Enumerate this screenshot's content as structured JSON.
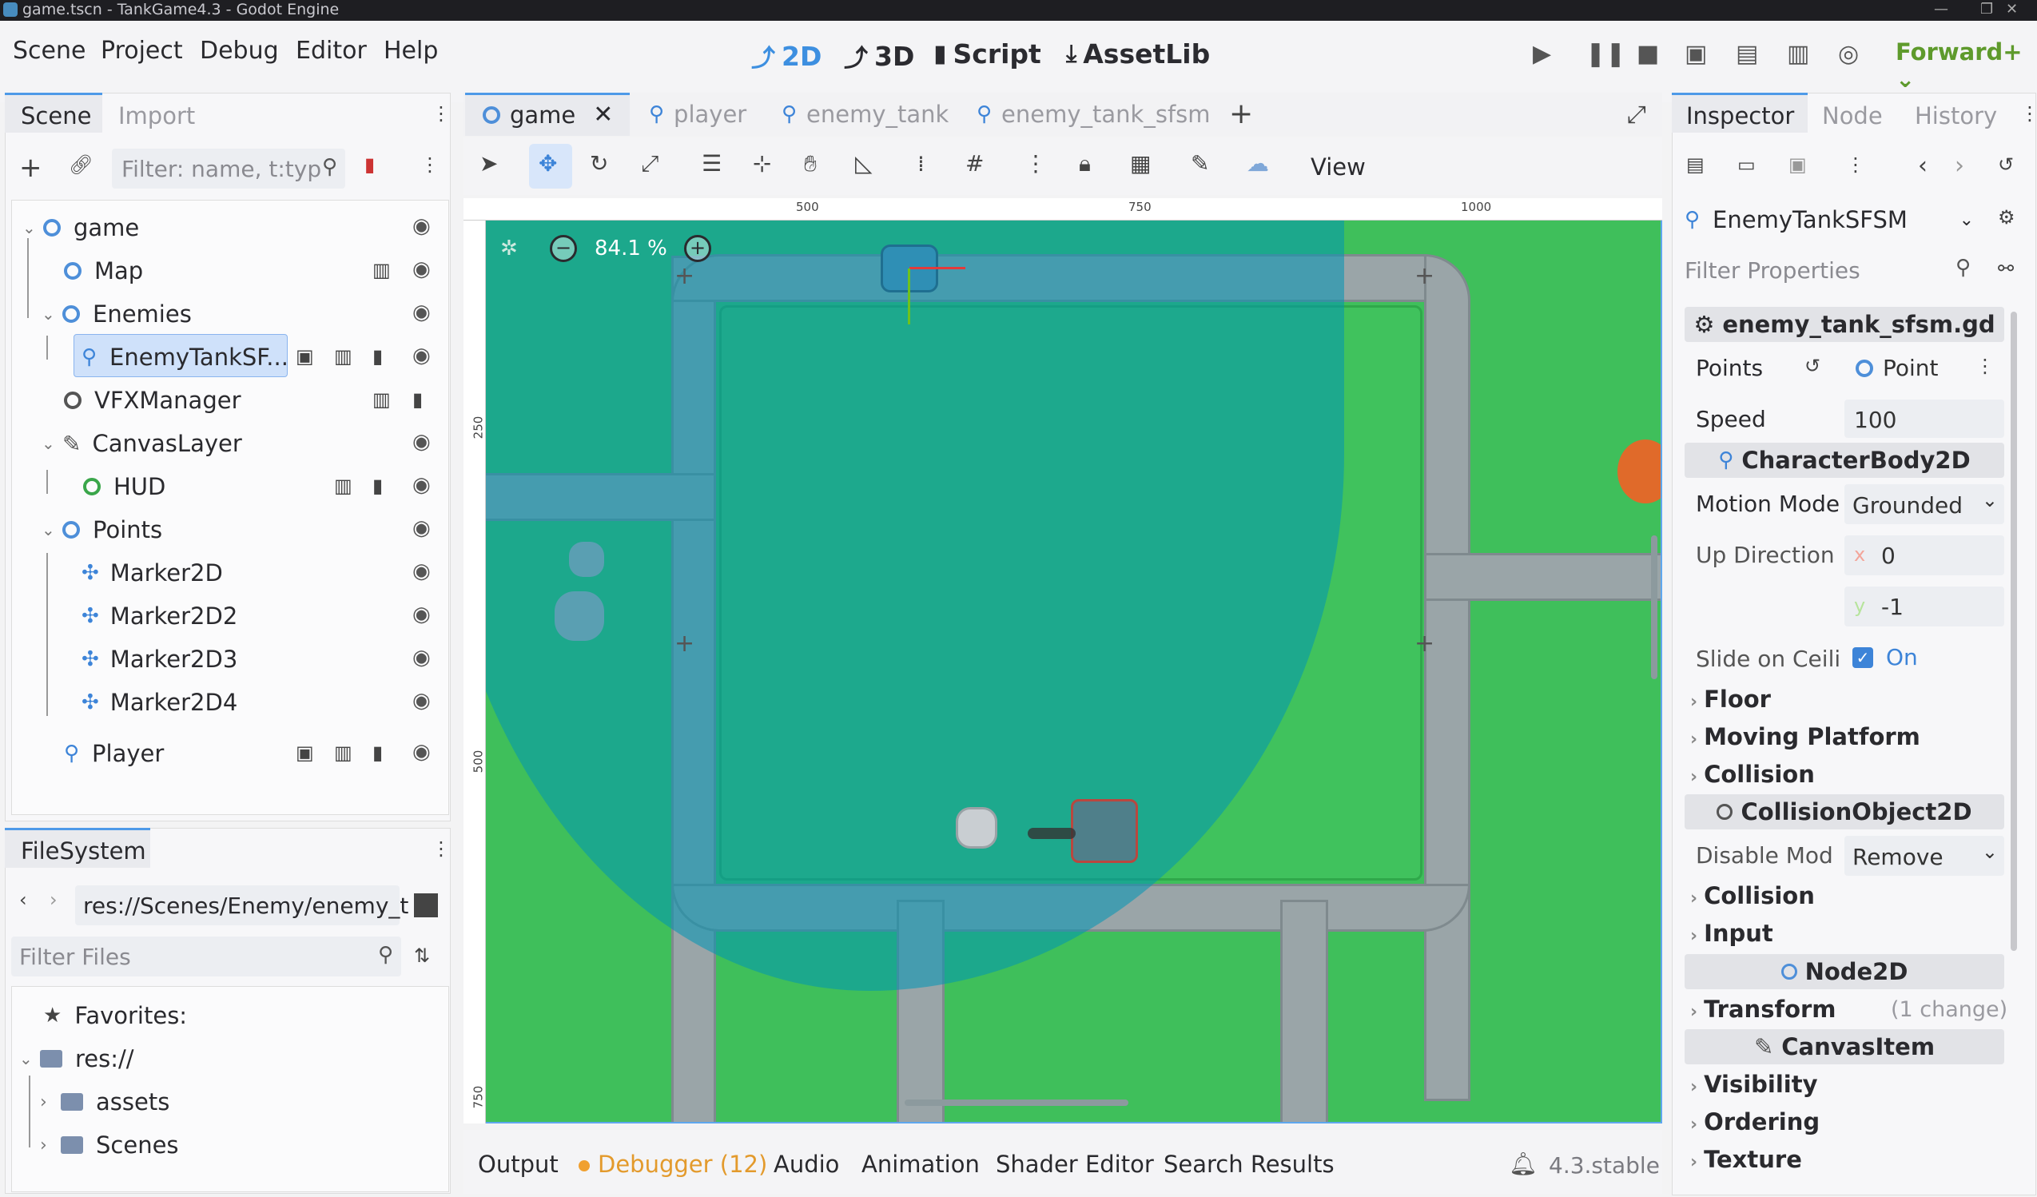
{
  "window": {
    "title": "game.tscn - TankGame4.3 - Godot Engine"
  },
  "menus": [
    "Scene",
    "Project",
    "Debug",
    "Editor",
    "Help"
  ],
  "workspaces": [
    {
      "label": "2D",
      "active": true
    },
    {
      "label": "3D",
      "active": false
    },
    {
      "label": "Script",
      "active": false
    },
    {
      "label": "AssetLib",
      "active": false
    }
  ],
  "renderer": "Forward+",
  "scene_dock": {
    "tabs": [
      "Scene",
      "Import"
    ],
    "filter_placeholder": "Filter: name, t:typ",
    "tree": [
      {
        "label": "game",
        "icon": "node2d-icon"
      },
      {
        "label": "Map",
        "icon": "node2d-icon"
      },
      {
        "label": "Enemies",
        "icon": "node2d-icon"
      },
      {
        "label": "EnemyTankSF...",
        "icon": "character-body-icon",
        "selected": true
      },
      {
        "label": "VFXManager",
        "icon": "node-icon"
      },
      {
        "label": "CanvasLayer",
        "icon": "canvas-layer-icon"
      },
      {
        "label": "HUD",
        "icon": "control-icon"
      },
      {
        "label": "Points",
        "icon": "node2d-icon"
      },
      {
        "label": "Marker2D",
        "icon": "marker-icon"
      },
      {
        "label": "Marker2D2",
        "icon": "marker-icon"
      },
      {
        "label": "Marker2D3",
        "icon": "marker-icon"
      },
      {
        "label": "Marker2D4",
        "icon": "marker-icon"
      },
      {
        "label": "Player",
        "icon": "character-body-icon"
      }
    ]
  },
  "filesystem": {
    "tab": "FileSystem",
    "path": "res://Scenes/Enemy/enemy_t",
    "filter_placeholder": "Filter Files",
    "items": [
      "Favorites:",
      "res://",
      "assets",
      "Scenes"
    ]
  },
  "editor_tabs": [
    "game",
    "player",
    "enemy_tank",
    "enemy_tank_sfsm"
  ],
  "viewport": {
    "zoom": "84.1 %",
    "view_label": "View",
    "ruler_h": [
      "500",
      "750",
      "1000"
    ],
    "ruler_v": [
      "250",
      "500",
      "750"
    ]
  },
  "bottom_tabs": [
    "Output",
    "Debugger (12)",
    "Audio",
    "Animation",
    "Shader Editor",
    "Search Results"
  ],
  "version": "4.3.stable",
  "inspector": {
    "tabs": [
      "Inspector",
      "Node",
      "History"
    ],
    "node_name": "EnemyTankSFSM",
    "filter_placeholder": "Filter Properties",
    "script": "enemy_tank_sfsm.gd",
    "points_label": "Points",
    "points_value": "Point",
    "speed_label": "Speed",
    "speed_value": "100",
    "class_characterbody": "CharacterBody2D",
    "motion_mode_label": "Motion Mode",
    "motion_mode_value": "Grounded",
    "up_direction_label": "Up Direction",
    "up_x": "0",
    "up_y": "-1",
    "slide_label": "Slide on Ceili",
    "slide_value": "On",
    "floor": "Floor",
    "moving_platform": "Moving Platform",
    "collision1": "Collision",
    "class_collisionobject": "CollisionObject2D",
    "disable_mode_label": "Disable Mod",
    "disable_mode_value": "Remove",
    "collision2": "Collision",
    "input": "Input",
    "class_node2d": "Node2D",
    "transform": "Transform",
    "transform_changes": "(1 change)",
    "class_canvasitem": "CanvasItem",
    "visibility": "Visibility",
    "ordering": "Ordering",
    "texture": "Texture"
  }
}
